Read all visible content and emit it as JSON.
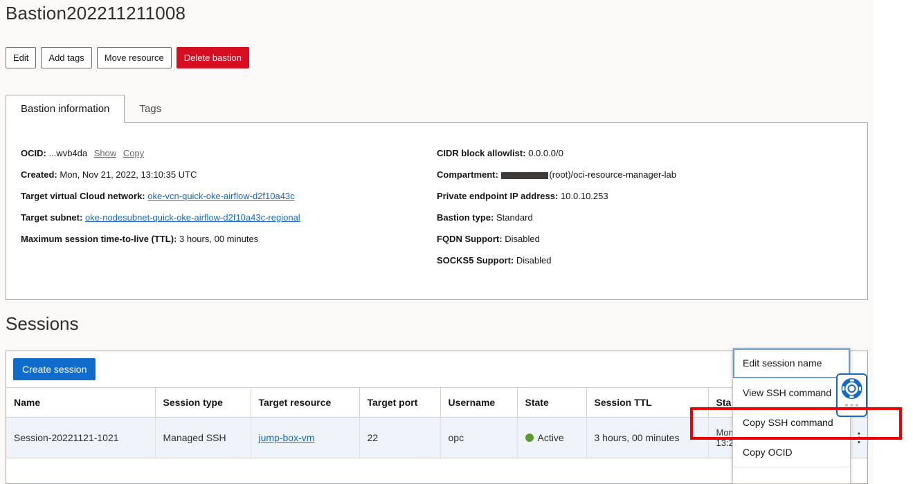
{
  "page": {
    "title": "Bastion202211211008"
  },
  "actions": {
    "edit": "Edit",
    "add_tags": "Add tags",
    "move_resource": "Move resource",
    "delete": "Delete bastion"
  },
  "tabs": [
    {
      "label": "Bastion information",
      "active": true
    },
    {
      "label": "Tags",
      "active": false
    }
  ],
  "info": {
    "ocid_label": "OCID:",
    "ocid_value": "...wvb4da",
    "ocid_show": "Show",
    "ocid_copy": "Copy",
    "created_label": "Created:",
    "created_value": "Mon, Nov 21, 2022, 13:10:35 UTC",
    "vcn_label": "Target virtual Cloud network:",
    "vcn_value": "oke-vcn-quick-oke-airflow-d2f10a43c",
    "subnet_label": "Target subnet:",
    "subnet_value": "oke-nodesubnet-quick-oke-airflow-d2f10a43c-regional",
    "ttl_label": "Maximum session time-to-live (TTL):",
    "ttl_value": "3 hours, 00 minutes",
    "cidr_label": "CIDR block allowlist:",
    "cidr_value": "0.0.0.0/0",
    "compartment_label": "Compartment:",
    "compartment_value": "(root)/oci-resource-manager-lab",
    "pe_label": "Private endpoint IP address:",
    "pe_value": "10.0.10.253",
    "type_label": "Bastion type:",
    "type_value": "Standard",
    "fqdn_label": "FQDN Support:",
    "fqdn_value": "Disabled",
    "socks_label": "SOCKS5 Support:",
    "socks_value": "Disabled"
  },
  "sessions": {
    "heading": "Sessions",
    "create_button": "Create session",
    "columns": [
      "Name",
      "Session type",
      "Target resource",
      "Target port",
      "Username",
      "State",
      "Session TTL",
      "Sta"
    ],
    "rows": [
      {
        "name": "Session-20221121-1021",
        "type": "Managed SSH",
        "resource": "jump-box-vm",
        "port": "22",
        "username": "opc",
        "state": "Active",
        "ttl": "3 hours, 00 minutes",
        "started_line1": "Mon",
        "started_line2": "13:2"
      }
    ]
  },
  "menu": {
    "items": [
      "Edit session name",
      "View SSH command",
      "Copy SSH command",
      "Copy OCID"
    ]
  },
  "colors": {
    "accent": "#0f6bcc",
    "danger": "#d70d22",
    "active_state": "#5b9a2b",
    "highlight": "#ee0000"
  }
}
